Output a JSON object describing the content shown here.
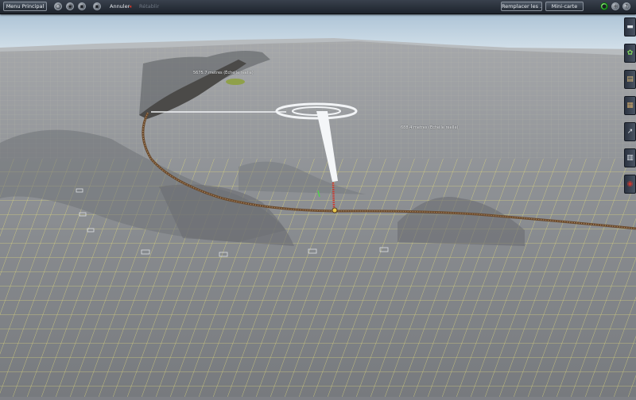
{
  "toolbar": {
    "menu_label": "Menu Principal",
    "btn1_icon": "○",
    "btn2_icon": "◉",
    "btn3_icon": "▪",
    "btn4_icon": "▪",
    "undo_label": "Annuler",
    "redo_label": "Rétablir",
    "replace_label": "Remplacer les ...",
    "minimap_label": "Mini-carte",
    "status_icon": "●",
    "add_icon": "+",
    "help_icon": "?"
  },
  "tools": [
    {
      "name": "track-tool",
      "icon": "▬"
    },
    {
      "name": "vegetation-tool",
      "icon": "✿"
    },
    {
      "name": "objects-tool",
      "icon": "▤"
    },
    {
      "name": "trains-tool",
      "icon": "▦"
    },
    {
      "name": "track-builder-tool",
      "icon": "↗"
    },
    {
      "name": "terrain-tool",
      "icon": "▥"
    },
    {
      "name": "camera-tool",
      "icon": "◉"
    }
  ],
  "viewport": {
    "measure1": "5675.7 metres  (Échelle réelle)",
    "measure2": "688.4 metres  (Échelle réelle)"
  },
  "colors": {
    "grid": "#e8e07a",
    "terrain": "#8c8f93",
    "track": "#6b4b2e"
  }
}
